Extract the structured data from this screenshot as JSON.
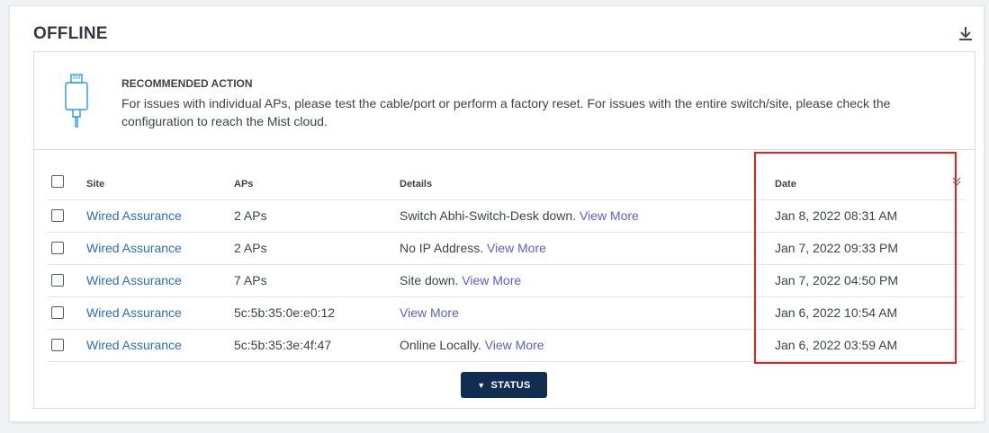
{
  "panel": {
    "title": "OFFLINE"
  },
  "recommendation": {
    "title": "RECOMMENDED ACTION",
    "text": "For issues with individual APs, please test the cable/port or perform a factory reset. For issues with the entire switch/site, please check the configuration to reach the Mist cloud."
  },
  "table": {
    "headers": {
      "site": "Site",
      "aps": "APs",
      "details": "Details",
      "date": "Date"
    },
    "rows": [
      {
        "site": "Wired Assurance",
        "aps": "2 APs",
        "details": "Switch Abhi-Switch-Desk down.",
        "link": "View More",
        "date": "Jan 8, 2022 08:31 AM"
      },
      {
        "site": "Wired Assurance",
        "aps": "2 APs",
        "details": "No IP Address.",
        "link": "View More",
        "date": "Jan 7, 2022 09:33 PM"
      },
      {
        "site": "Wired Assurance",
        "aps": "7 APs",
        "details": "Site down.",
        "link": "View More",
        "date": "Jan 7, 2022 04:50 PM"
      },
      {
        "site": "Wired Assurance",
        "aps": "5c:5b:35:0e:e0:12",
        "details": "",
        "link": "View More",
        "date": "Jan 6, 2022 10:54 AM"
      },
      {
        "site": "Wired Assurance",
        "aps": "5c:5b:35:3e:4f:47",
        "details": "Online Locally.",
        "link": "View More",
        "date": "Jan 6, 2022 03:59 AM"
      }
    ]
  },
  "status_button": {
    "label": "STATUS",
    "icon": "triangle-down-icon"
  },
  "icons": {
    "download": "download-icon",
    "sort": "double-chevron-down-icon",
    "recommendation": "ethernet-cable-icon"
  },
  "colors": {
    "link": "#2f6bb5",
    "view_more": "#5b5fc7",
    "button_bg": "#0f2e52",
    "highlight": "#e0241b"
  }
}
